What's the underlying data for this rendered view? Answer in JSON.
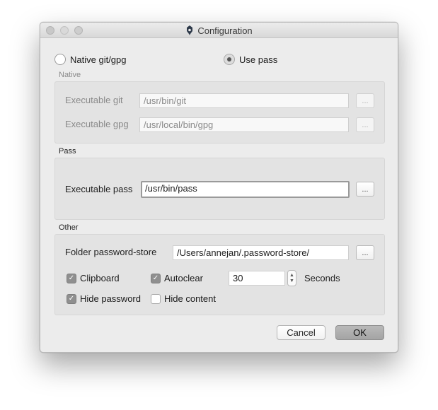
{
  "window": {
    "title": "Configuration"
  },
  "mode": {
    "native_label": "Native git/gpg",
    "pass_label": "Use pass",
    "selected": "pass"
  },
  "native": {
    "group_title": "Native",
    "git_label": "Executable git",
    "git_value": "/usr/bin/git",
    "gpg_label": "Executable gpg",
    "gpg_value": "/usr/local/bin/gpg",
    "browse_label": "..."
  },
  "pass": {
    "group_title": "Pass",
    "pass_label": "Executable pass",
    "pass_value": "/usr/bin/pass",
    "browse_label": "..."
  },
  "other": {
    "group_title": "Other",
    "store_label": "Folder password-store",
    "store_value": "/Users/annejan/.password-store/",
    "browse_label": "...",
    "clipboard_label": "Clipboard",
    "clipboard_checked": true,
    "autoclear_label": "Autoclear",
    "autoclear_checked": true,
    "autoclear_seconds": "30",
    "seconds_label": "Seconds",
    "hide_password_label": "Hide password",
    "hide_password_checked": true,
    "hide_content_label": "Hide content",
    "hide_content_checked": false
  },
  "buttons": {
    "cancel": "Cancel",
    "ok": "OK"
  },
  "icons": {
    "traffic_close": "close-icon",
    "traffic_minimize": "minimize-icon",
    "traffic_maximize": "maximize-icon",
    "app": "lock-heart-icon",
    "stepper": "stepper-icon",
    "check": "checkmark-icon"
  }
}
